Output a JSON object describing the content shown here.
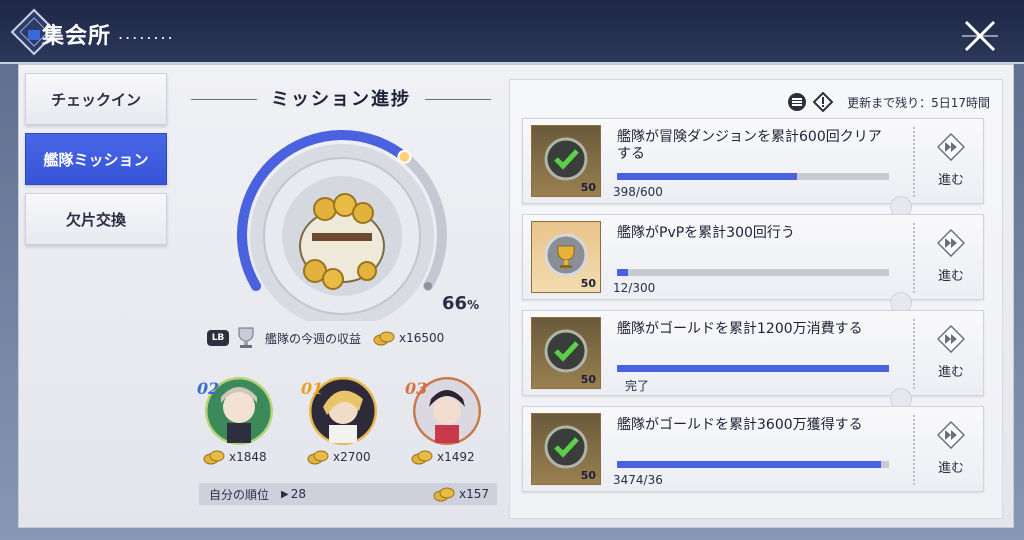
{
  "header": {
    "title": "集会所",
    "title_dots": "........",
    "crest_icon": "shield-crest-icon",
    "close_icon": "close-icon"
  },
  "nav": {
    "items": [
      {
        "label": "チェックイン",
        "active": false
      },
      {
        "label": "艦隊ミッション",
        "active": true
      },
      {
        "label": "欠片交換",
        "active": false
      }
    ]
  },
  "progress": {
    "section_title": "ミッション進捗",
    "percent_value": "66",
    "percent_sign": "%",
    "fraction": 0.66,
    "lb_badge": "LB",
    "earnings_label": "艦隊の今週の収益",
    "earnings_amount": "x16500"
  },
  "ranking": {
    "entries": [
      {
        "rank": "02",
        "amount": "x1848",
        "rank_color": "#3a6ad8"
      },
      {
        "rank": "01",
        "amount": "x2700",
        "rank_color": "#e8a020"
      },
      {
        "rank": "03",
        "amount": "x1492",
        "rank_color": "#d8703a"
      }
    ],
    "my_rank_label": "自分の順位",
    "my_rank_value": "28",
    "my_amount": "x157"
  },
  "missions": {
    "refresh_label": "更新まで残り：",
    "refresh_value": "5日17時間",
    "list_icon": "list-icon",
    "info_icon": "exclamation-diamond-icon",
    "go_label": "進む",
    "items": [
      {
        "text": "艦隊が冒険ダンジョンを累計600回クリアする",
        "progress": "398/600",
        "ratio": 0.663,
        "reward_count": "50",
        "icon": "check-icon",
        "done": false
      },
      {
        "text": "艦隊がPvPを累計300回行う",
        "progress": "12/300",
        "ratio": 0.04,
        "reward_count": "50",
        "icon": "trophy-icon",
        "done": false
      },
      {
        "text": "艦隊がゴールドを累計1200万消費する",
        "progress": "完了",
        "ratio": 1.0,
        "reward_count": "50",
        "icon": "check-icon",
        "done": true
      },
      {
        "text": "艦隊がゴールドを累計3600万獲得する",
        "progress": "3474/36",
        "ratio": 0.97,
        "reward_count": "50",
        "icon": "check-icon",
        "done": false
      }
    ]
  },
  "colors": {
    "accent": "#3854d6",
    "bar_fill": "#4a62e0",
    "header_bg": "#1e2744"
  }
}
